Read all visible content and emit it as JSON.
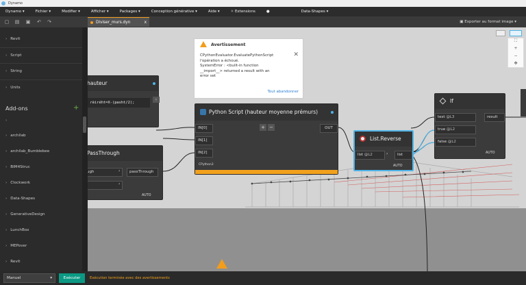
{
  "window": {
    "title": "Dynamo"
  },
  "menu": [
    "Dynamo",
    "Fichier",
    "Modifier",
    "Afficher",
    "Packages",
    "Conception générative",
    "Aide",
    "Extensions",
    "Data-Shapes"
  ],
  "tab": {
    "label": "Diviser_murs.dyn",
    "close": "x"
  },
  "export_label": "Exporter au format image",
  "sidebar": {
    "top_items": [
      "Revit",
      "Script",
      "String",
      "Units"
    ],
    "addons_title": "Add-ons",
    "addons_add": "+",
    "addon_items": [
      "",
      "archilab",
      "archilab_Bumblebee",
      "BIM4Struc",
      "Clockwork",
      "Data-Shapes",
      "GenerativeDesign",
      "LunchBox",
      "MEPover",
      "Revit"
    ]
  },
  "nodes": {
    "hauteur": {
      "title": "hauteur",
      "code": "= rèiréht=X-(pasht/2);"
    },
    "passthrough": {
      "title": "PassThrough",
      "in1": "ugh",
      "out": "passThrough",
      "auto": "AUTO"
    },
    "python": {
      "title": "Python Script (hauteur moyenne prémurs)",
      "inputs": [
        "IN[0]",
        "IN[1]",
        "IN[2]"
      ],
      "output": "OUT",
      "footer": "CPython3",
      "plus": "+",
      "minus": "−"
    },
    "reverse": {
      "title": "List.Reverse",
      "in": "list",
      "lacing": "@L2",
      "out": "list",
      "auto": "AUTO"
    },
    "if": {
      "title": "If",
      "inputs": [
        {
          "name": "test",
          "lacing": "@L3"
        },
        {
          "name": "true",
          "lacing": "@L2"
        },
        {
          "name": "false",
          "lacing": "@L2"
        }
      ],
      "output": "result",
      "auto": "AUTO"
    }
  },
  "warning": {
    "title": "Avertissement",
    "message": "CPythonEvaluator.EvaluatePythonScript\nl'opération a échoué.\nSystemError : <built-in function\n__import__> returned a result with an\nerror set",
    "abort": "Tout abandonner"
  },
  "zoom": [
    "+",
    "−"
  ],
  "statusbar": {
    "run_mode": "Manuel",
    "run_button": "Exécuter",
    "message": "Exécution terminée avec des avertissements"
  },
  "colors": {
    "accent": "#f2a11c",
    "selection": "#4fb3e6",
    "run": "#0b9984"
  }
}
